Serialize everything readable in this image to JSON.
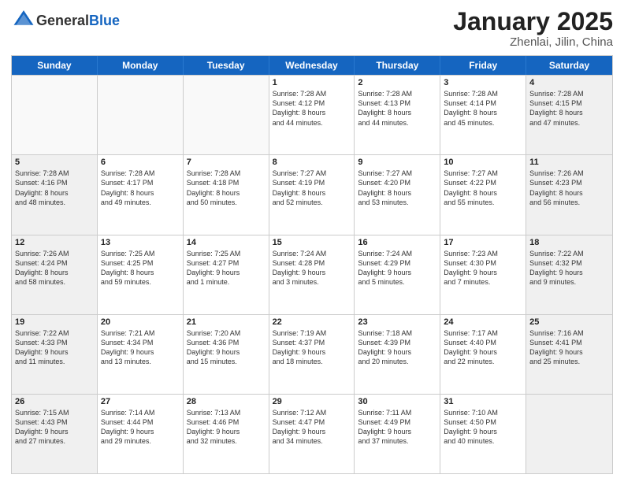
{
  "header": {
    "logo_general": "General",
    "logo_blue": "Blue",
    "title": "January 2025",
    "location": "Zhenlai, Jilin, China"
  },
  "days_of_week": [
    "Sunday",
    "Monday",
    "Tuesday",
    "Wednesday",
    "Thursday",
    "Friday",
    "Saturday"
  ],
  "weeks": [
    [
      {
        "day": "",
        "info": "",
        "shaded": false
      },
      {
        "day": "",
        "info": "",
        "shaded": false
      },
      {
        "day": "",
        "info": "",
        "shaded": false
      },
      {
        "day": "1",
        "info": "Sunrise: 7:28 AM\nSunset: 4:12 PM\nDaylight: 8 hours\nand 44 minutes.",
        "shaded": false
      },
      {
        "day": "2",
        "info": "Sunrise: 7:28 AM\nSunset: 4:13 PM\nDaylight: 8 hours\nand 44 minutes.",
        "shaded": false
      },
      {
        "day": "3",
        "info": "Sunrise: 7:28 AM\nSunset: 4:14 PM\nDaylight: 8 hours\nand 45 minutes.",
        "shaded": false
      },
      {
        "day": "4",
        "info": "Sunrise: 7:28 AM\nSunset: 4:15 PM\nDaylight: 8 hours\nand 47 minutes.",
        "shaded": true
      }
    ],
    [
      {
        "day": "5",
        "info": "Sunrise: 7:28 AM\nSunset: 4:16 PM\nDaylight: 8 hours\nand 48 minutes.",
        "shaded": true
      },
      {
        "day": "6",
        "info": "Sunrise: 7:28 AM\nSunset: 4:17 PM\nDaylight: 8 hours\nand 49 minutes.",
        "shaded": false
      },
      {
        "day": "7",
        "info": "Sunrise: 7:28 AM\nSunset: 4:18 PM\nDaylight: 8 hours\nand 50 minutes.",
        "shaded": false
      },
      {
        "day": "8",
        "info": "Sunrise: 7:27 AM\nSunset: 4:19 PM\nDaylight: 8 hours\nand 52 minutes.",
        "shaded": false
      },
      {
        "day": "9",
        "info": "Sunrise: 7:27 AM\nSunset: 4:20 PM\nDaylight: 8 hours\nand 53 minutes.",
        "shaded": false
      },
      {
        "day": "10",
        "info": "Sunrise: 7:27 AM\nSunset: 4:22 PM\nDaylight: 8 hours\nand 55 minutes.",
        "shaded": false
      },
      {
        "day": "11",
        "info": "Sunrise: 7:26 AM\nSunset: 4:23 PM\nDaylight: 8 hours\nand 56 minutes.",
        "shaded": true
      }
    ],
    [
      {
        "day": "12",
        "info": "Sunrise: 7:26 AM\nSunset: 4:24 PM\nDaylight: 8 hours\nand 58 minutes.",
        "shaded": true
      },
      {
        "day": "13",
        "info": "Sunrise: 7:25 AM\nSunset: 4:25 PM\nDaylight: 8 hours\nand 59 minutes.",
        "shaded": false
      },
      {
        "day": "14",
        "info": "Sunrise: 7:25 AM\nSunset: 4:27 PM\nDaylight: 9 hours\nand 1 minute.",
        "shaded": false
      },
      {
        "day": "15",
        "info": "Sunrise: 7:24 AM\nSunset: 4:28 PM\nDaylight: 9 hours\nand 3 minutes.",
        "shaded": false
      },
      {
        "day": "16",
        "info": "Sunrise: 7:24 AM\nSunset: 4:29 PM\nDaylight: 9 hours\nand 5 minutes.",
        "shaded": false
      },
      {
        "day": "17",
        "info": "Sunrise: 7:23 AM\nSunset: 4:30 PM\nDaylight: 9 hours\nand 7 minutes.",
        "shaded": false
      },
      {
        "day": "18",
        "info": "Sunrise: 7:22 AM\nSunset: 4:32 PM\nDaylight: 9 hours\nand 9 minutes.",
        "shaded": true
      }
    ],
    [
      {
        "day": "19",
        "info": "Sunrise: 7:22 AM\nSunset: 4:33 PM\nDaylight: 9 hours\nand 11 minutes.",
        "shaded": true
      },
      {
        "day": "20",
        "info": "Sunrise: 7:21 AM\nSunset: 4:34 PM\nDaylight: 9 hours\nand 13 minutes.",
        "shaded": false
      },
      {
        "day": "21",
        "info": "Sunrise: 7:20 AM\nSunset: 4:36 PM\nDaylight: 9 hours\nand 15 minutes.",
        "shaded": false
      },
      {
        "day": "22",
        "info": "Sunrise: 7:19 AM\nSunset: 4:37 PM\nDaylight: 9 hours\nand 18 minutes.",
        "shaded": false
      },
      {
        "day": "23",
        "info": "Sunrise: 7:18 AM\nSunset: 4:39 PM\nDaylight: 9 hours\nand 20 minutes.",
        "shaded": false
      },
      {
        "day": "24",
        "info": "Sunrise: 7:17 AM\nSunset: 4:40 PM\nDaylight: 9 hours\nand 22 minutes.",
        "shaded": false
      },
      {
        "day": "25",
        "info": "Sunrise: 7:16 AM\nSunset: 4:41 PM\nDaylight: 9 hours\nand 25 minutes.",
        "shaded": true
      }
    ],
    [
      {
        "day": "26",
        "info": "Sunrise: 7:15 AM\nSunset: 4:43 PM\nDaylight: 9 hours\nand 27 minutes.",
        "shaded": true
      },
      {
        "day": "27",
        "info": "Sunrise: 7:14 AM\nSunset: 4:44 PM\nDaylight: 9 hours\nand 29 minutes.",
        "shaded": false
      },
      {
        "day": "28",
        "info": "Sunrise: 7:13 AM\nSunset: 4:46 PM\nDaylight: 9 hours\nand 32 minutes.",
        "shaded": false
      },
      {
        "day": "29",
        "info": "Sunrise: 7:12 AM\nSunset: 4:47 PM\nDaylight: 9 hours\nand 34 minutes.",
        "shaded": false
      },
      {
        "day": "30",
        "info": "Sunrise: 7:11 AM\nSunset: 4:49 PM\nDaylight: 9 hours\nand 37 minutes.",
        "shaded": false
      },
      {
        "day": "31",
        "info": "Sunrise: 7:10 AM\nSunset: 4:50 PM\nDaylight: 9 hours\nand 40 minutes.",
        "shaded": false
      },
      {
        "day": "",
        "info": "",
        "shaded": true
      }
    ]
  ]
}
